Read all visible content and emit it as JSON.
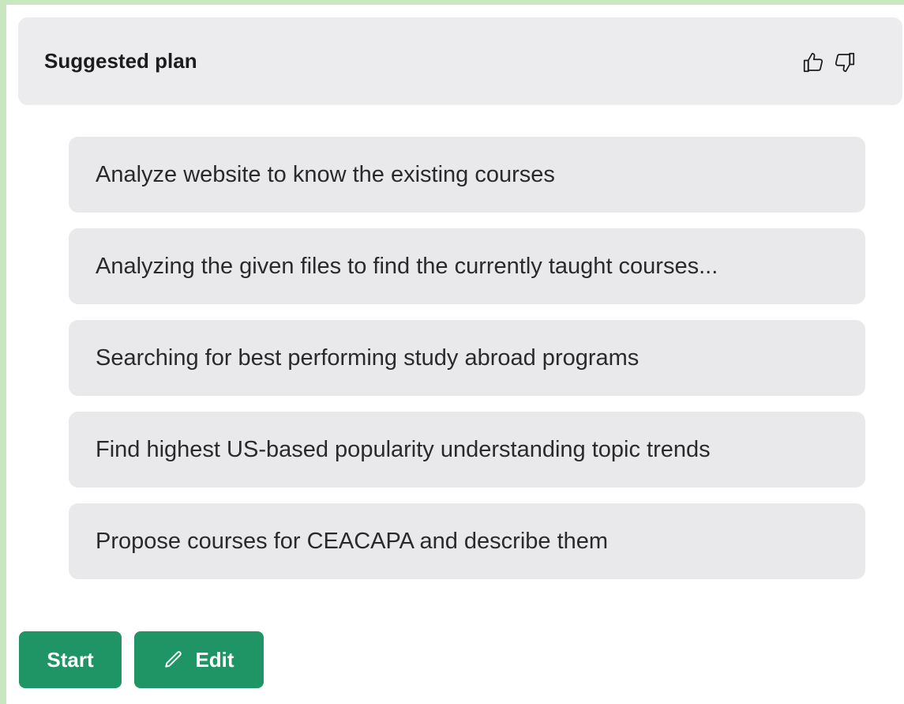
{
  "header": {
    "title": "Suggested plan",
    "thumbs_up_icon": "thumbs-up-icon",
    "thumbs_down_icon": "thumbs-down-icon"
  },
  "steps": [
    {
      "label": "Analyze website to know the existing courses"
    },
    {
      "label": "Analyzing the given files to find the currently taught courses..."
    },
    {
      "label": "Searching for best performing study abroad programs"
    },
    {
      "label": "Find highest US-based popularity understanding topic trends"
    },
    {
      "label": "Propose courses for CEACAPA and describe them"
    }
  ],
  "actions": {
    "start_label": "Start",
    "edit_label": "Edit",
    "edit_icon": "pencil-icon"
  },
  "colors": {
    "background": "#c8e6c0",
    "header_bg": "#ececee",
    "step_bg": "#e9e9eb",
    "accent": "#1f9464"
  }
}
